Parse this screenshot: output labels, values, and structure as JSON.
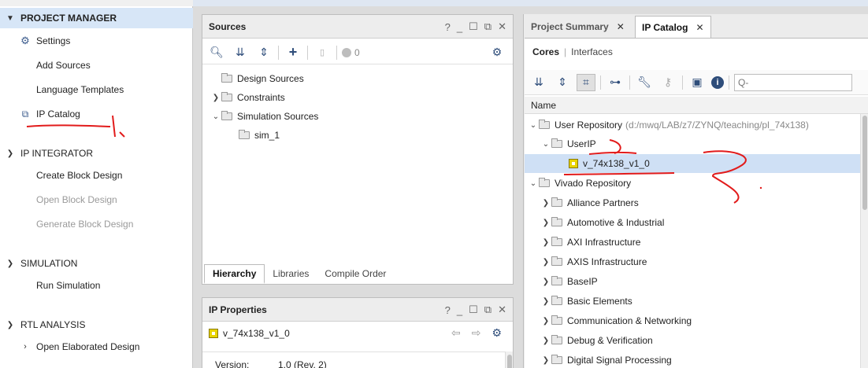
{
  "flow_navigator": {
    "sections": [
      {
        "label": "PROJECT MANAGER",
        "items": [
          "Settings",
          "Add Sources",
          "Language Templates",
          "IP Catalog"
        ]
      },
      {
        "label": "IP INTEGRATOR",
        "items": [
          "Create Block Design",
          "Open Block Design",
          "Generate Block Design"
        ]
      },
      {
        "label": "SIMULATION",
        "items": [
          "Run Simulation"
        ]
      },
      {
        "label": "RTL ANALYSIS",
        "items": [
          "Open Elaborated Design"
        ]
      }
    ]
  },
  "sources": {
    "title": "Sources",
    "status_count": "0",
    "tree": [
      "Design Sources",
      "Constraints",
      "Simulation Sources",
      "sim_1"
    ],
    "tabs": [
      "Hierarchy",
      "Libraries",
      "Compile Order"
    ]
  },
  "ip_properties": {
    "title": "IP Properties",
    "selected_ip": "v_74x138_v1_0",
    "version_label": "Version:",
    "version_value": "1.0 (Rev. 2)"
  },
  "right_tabs": [
    "Project Summary",
    "IP Catalog"
  ],
  "catalog": {
    "subtabs": [
      "Cores",
      "Interfaces"
    ],
    "search_placeholder": "Q-",
    "column_name": "Name",
    "user_repo": "User Repository",
    "user_repo_path": "(d:/mwq/LAB/z7/ZYNQ/teaching/pl_74x138)",
    "userip": "UserIP",
    "ip_item": "v_74x138_v1_0",
    "vivado_repo": "Vivado Repository",
    "categories": [
      "Alliance Partners",
      "Automotive & Industrial",
      "AXI Infrastructure",
      "AXIS Infrastructure",
      "BaseIP",
      "Basic Elements",
      "Communication & Networking",
      "Debug & Verification",
      "Digital Signal Processing"
    ]
  },
  "colors": {
    "accent": "#d7e6f7",
    "selection": "#cfe0f5",
    "annotation_red": "#e21b1b",
    "ip_yellow": "#e8d300"
  }
}
